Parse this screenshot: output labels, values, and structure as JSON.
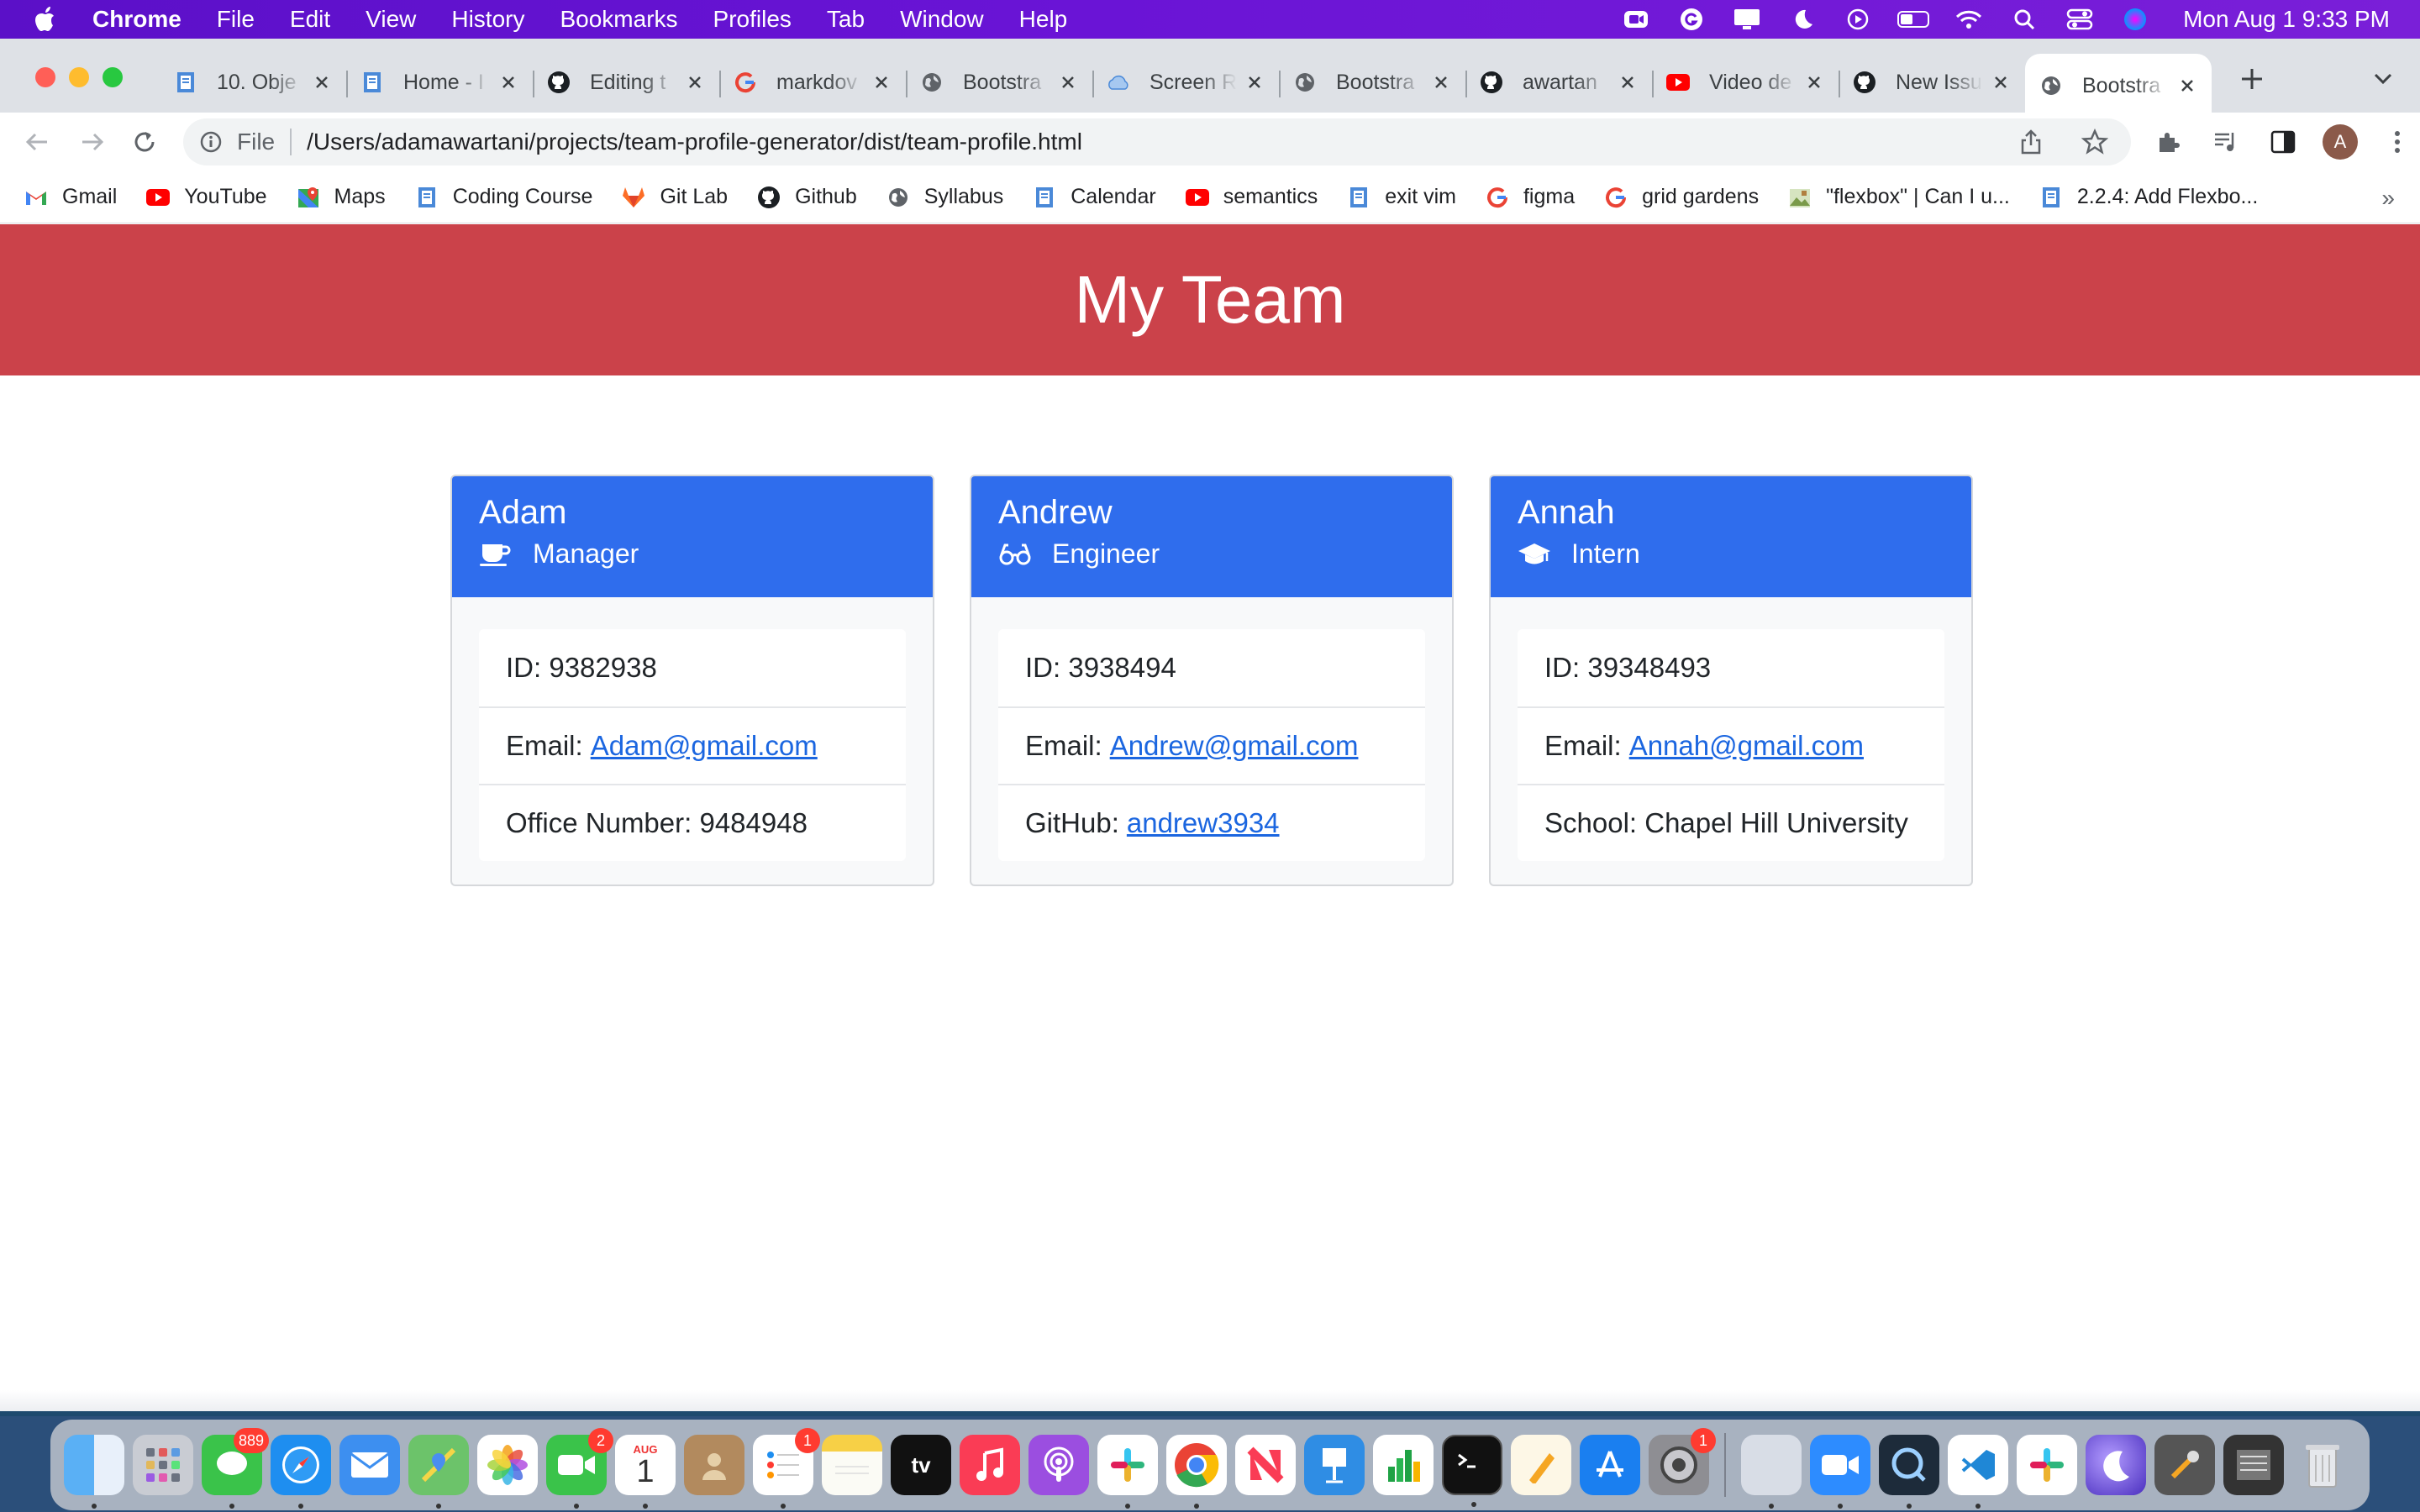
{
  "menubar": {
    "app_name": "Chrome",
    "menus": [
      "File",
      "Edit",
      "View",
      "History",
      "Bookmarks",
      "Profiles",
      "Tab",
      "Window",
      "Help"
    ],
    "clock": "Mon Aug 1  9:33 PM"
  },
  "tabs": [
    {
      "title": "10. Obje",
      "icon": "doc-icon"
    },
    {
      "title": "Home - I",
      "icon": "doc-icon"
    },
    {
      "title": "Editing t",
      "icon": "github-icon"
    },
    {
      "title": "markdov",
      "icon": "google-icon"
    },
    {
      "title": "Bootstra",
      "icon": "globe-icon"
    },
    {
      "title": "Screen R",
      "icon": "cloud-icon"
    },
    {
      "title": "Bootstra",
      "icon": "globe-icon"
    },
    {
      "title": "awartan",
      "icon": "github-icon"
    },
    {
      "title": "Video de",
      "icon": "youtube-icon"
    },
    {
      "title": "New Issu",
      "icon": "github-icon"
    },
    {
      "title": "Bootstra",
      "icon": "globe-icon",
      "active": true
    }
  ],
  "omnibox": {
    "scheme": "File",
    "url": "/Users/adamawartani/projects/team-profile-generator/dist/team-profile.html"
  },
  "profile_initial": "A",
  "bookmarks": [
    {
      "label": "Gmail",
      "icon": "gmail-icon"
    },
    {
      "label": "YouTube",
      "icon": "youtube-icon"
    },
    {
      "label": "Maps",
      "icon": "maps-icon"
    },
    {
      "label": "Coding Course",
      "icon": "doc-icon"
    },
    {
      "label": "Git Lab",
      "icon": "gitlab-icon"
    },
    {
      "label": "Github",
      "icon": "github-icon"
    },
    {
      "label": "Syllabus",
      "icon": "globe-icon"
    },
    {
      "label": "Calendar",
      "icon": "doc-icon"
    },
    {
      "label": "semantics",
      "icon": "youtube-icon"
    },
    {
      "label": "exit vim",
      "icon": "doc-icon"
    },
    {
      "label": "figma",
      "icon": "google-icon"
    },
    {
      "label": "grid gardens",
      "icon": "google-icon"
    },
    {
      "label": "\"flexbox\" | Can I u...",
      "icon": "image-icon"
    },
    {
      "label": "2.2.4: Add Flexbo...",
      "icon": "doc-icon"
    }
  ],
  "bookmarks_overflow": "»",
  "page": {
    "heading": "My Team",
    "cards": [
      {
        "name": "Adam",
        "role": "Manager",
        "role_icon": "coffee-mug-icon",
        "id_label": "ID: 9382938",
        "email_prefix": "Email:",
        "email": "Adam@gmail.com",
        "extra_prefix": "Office Number: 9484948",
        "extra_link": ""
      },
      {
        "name": "Andrew",
        "role": "Engineer",
        "role_icon": "glasses-icon",
        "id_label": "ID: 3938494",
        "email_prefix": "Email:",
        "email": "Andrew@gmail.com",
        "extra_prefix": "GitHub:",
        "extra_link": "andrew3934"
      },
      {
        "name": "Annah",
        "role": "Intern",
        "role_icon": "graduation-cap-icon",
        "id_label": "ID: 39348493",
        "email_prefix": "Email:",
        "email": "Annah@gmail.com",
        "extra_prefix": "School: Chapel Hill University",
        "extra_link": ""
      }
    ]
  },
  "dock": {
    "badges": {
      "messages": "889",
      "facetime": "2",
      "reminders": "1",
      "system_prefs": "1"
    },
    "calendar": {
      "month": "AUG",
      "day": "1"
    },
    "tv_label": "tv"
  },
  "colors": {
    "menubar": "#6a14d6",
    "header_red": "#cb424a",
    "card_header_blue": "#2f6ded",
    "link": "#1b66e0"
  }
}
